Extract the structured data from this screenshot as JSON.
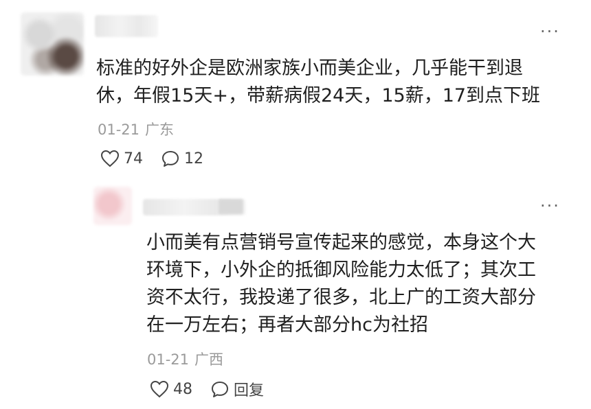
{
  "comment": {
    "text_line1": "标准的好外企是欧洲家族小而美企业，几乎能干到退",
    "text_line2": "休，年假15天+，带薪病假24天，15薪，17到点下班",
    "date": "01-21",
    "location": "广东",
    "like_count": "74",
    "reply_count": "12",
    "like_icon": "heart-outline-icon",
    "reply_icon": "speech-bubble-icon",
    "more_icon": "more-dots-icon"
  },
  "reply": {
    "text_line1": "小而美有点营销号宣传起来的感觉，本身这个大",
    "text_line2": "环境下，小外企的抵御风险能力太低了；其次工",
    "text_line3": "资不太行，我投递了很多，北上广的工资大部分",
    "text_line4": "在一万左右；再者大部分hc为社招",
    "date": "01-21",
    "location": "广西",
    "like_count": "48",
    "reply_label": "回复",
    "like_icon": "heart-outline-icon",
    "reply_icon": "speech-bubble-icon",
    "more_icon": "more-dots-icon"
  },
  "more_glyph": "···",
  "colors": {
    "text": "#1f1f1f",
    "meta": "#9a9a9a",
    "icon": "#444444"
  }
}
